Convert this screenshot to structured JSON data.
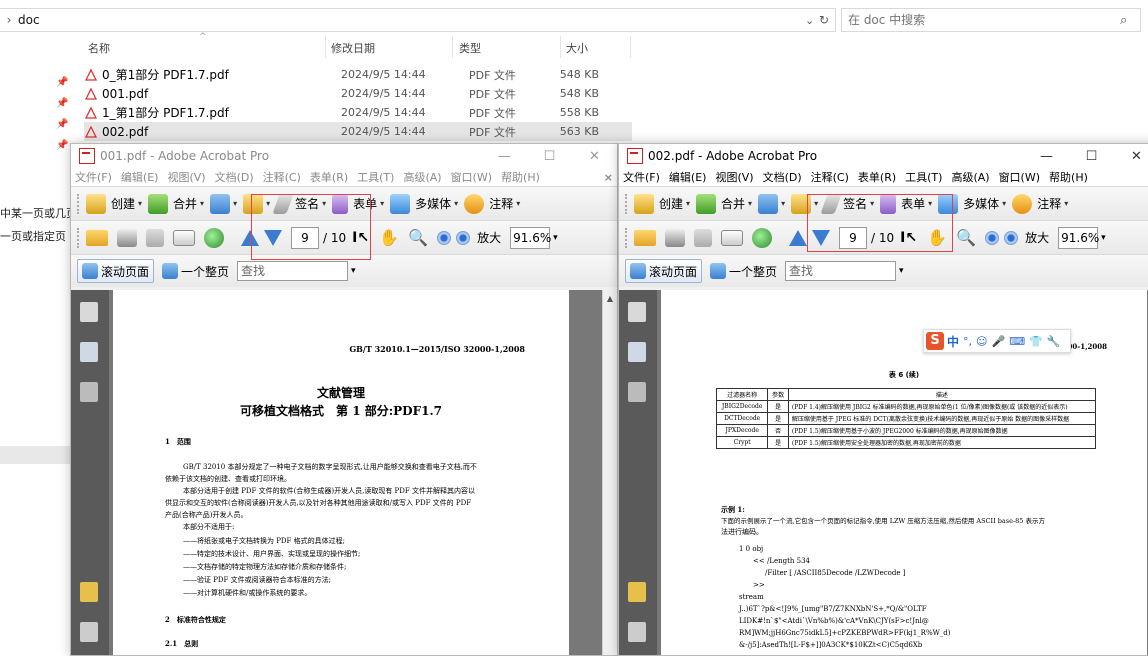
{
  "explorer": {
    "path": "doc",
    "search_placeholder": "在 doc 中搜索",
    "columns": {
      "name": "名称",
      "date": "修改日期",
      "type": "类型",
      "size": "大小"
    },
    "files": [
      {
        "name": "0_第1部分 PDF1.7.pdf",
        "date": "2024/9/5 14:44",
        "type": "PDF 文件",
        "size": "548 KB"
      },
      {
        "name": "001.pdf",
        "date": "2024/9/5 14:44",
        "type": "PDF 文件",
        "size": "548 KB"
      },
      {
        "name": "1_第1部分 PDF1.7.pdf",
        "date": "2024/9/5 14:44",
        "type": "PDF 文件",
        "size": "558 KB"
      },
      {
        "name": "002.pdf",
        "date": "2024/9/5 14:44",
        "type": "PDF 文件",
        "size": "563 KB"
      }
    ],
    "left_fragments": [
      "中某一页或几页",
      "一页或指定页"
    ]
  },
  "window1": {
    "title": "001.pdf - Adobe Acrobat Pro",
    "menu": [
      "文件(F)",
      "编辑(E)",
      "视图(V)",
      "文档(D)",
      "注释(C)",
      "表单(R)",
      "工具(T)",
      "高级(A)",
      "窗口(W)",
      "帮助(H)"
    ],
    "menu_close": "×",
    "toolbar1": {
      "create": "创建",
      "combine": "合并",
      "sign": "签名",
      "forms": "表单",
      "multimedia": "多媒体",
      "comment": "注释"
    },
    "toolbar2": {
      "page": "9",
      "total": "/ 10",
      "zoom_in": "放大",
      "zoom": "91.6%"
    },
    "toolbar3": {
      "scroll": "滚动页面",
      "single": "一个整页",
      "find_placeholder": "查找"
    },
    "doc": {
      "std": "GB/T 32010.1—2015/ISO 32000-1,2008",
      "title1": "文献管理",
      "title2": "可移植文档格式　第 1 部分:PDF1.7",
      "sec1": "1　范围",
      "p1": "GB/T 32010 本部分规定了一种电子文档的数字呈现形式,让用户能够交换和查看电子文档,而不",
      "p1b": "依赖于该文档的创建、查看或打印环境。",
      "p2": "本部分适用于创建 PDF 文件的软件(合称生成器)开发人员,读取现有 PDF 文件并解释其内容以",
      "p2b": "供显示和交互的软件(合称阅读器)开发人员,以及针对各种其他用途读取和/或写入 PDF 文件的 PDF",
      "p2c": "产品(合称产品)开发人员。",
      "p3": "本部分不适用于:",
      "l1": "——将纸张或电子文档转换为 PDF 格式的具体过程;",
      "l2": "——特定的技术设计、用户界面、实现或呈现的操作细节;",
      "l3": "——文档存储的特定物理方法如存储介质和存储条件;",
      "l4": "——验证 PDF 文件或阅读器符合本标准的方法;",
      "l5": "——对计算机硬件和/或操作系统的要求。",
      "sec2": "2　标准符合性规定",
      "sec21": "2.1　总则"
    }
  },
  "window2": {
    "title": "002.pdf - Adobe Acrobat Pro",
    "menu": [
      "文件(F)",
      "编辑(E)",
      "视图(V)",
      "文档(D)",
      "注释(C)",
      "表单(R)",
      "工具(T)",
      "高级(A)",
      "窗口(W)",
      "帮助(H)"
    ],
    "toolbar1": {
      "create": "创建",
      "combine": "合并",
      "sign": "签名",
      "forms": "表单",
      "multimedia": "多媒体",
      "comment": "注释"
    },
    "toolbar2": {
      "page": "9",
      "total": "/ 10",
      "zoom_in": "放大",
      "zoom": "91.6%"
    },
    "toolbar3": {
      "scroll": "滚动页面",
      "single": "一个整页",
      "find_placeholder": "查找"
    },
    "ime": {
      "zh": "中"
    },
    "doc": {
      "std": "GB/T 32010.1—2015/ISO 32000-1,2008",
      "table_caption": "表 6 (续)",
      "table_headers": [
        "过滤器名称",
        "参数",
        "描述"
      ],
      "table_rows": [
        [
          "JBIG2Decode",
          "是",
          "(PDF 1.4)解压缩使用 JBIG2 标准编码的数据,再现原始单色(1 位/像素)图像数据(或 该数据的近似表示)"
        ],
        [
          "DCTDecode",
          "是",
          "解压缩使用基于 JPEG 标准的 DCT(离散余弦变换)技术编码的数据,再现近似于原始 数据的图像采样数据"
        ],
        [
          "JPXDecode",
          "否",
          "(PDF 1.5)解压缩使用基于小波的 JPEG2000 标准编码的数据,再现原始图像数据"
        ],
        [
          "Crypt",
          "是",
          "(PDF 1.5)解压缩使用安全处理器加密的数据,再现加密前的数据"
        ]
      ],
      "ex": "示例 1:",
      "ex1": "下面的示例展示了一个流,它包含一个页面的标记指令,使用 LZW 压缩方法压缩,然后使用 ASCII base-85 表示方",
      "ex1b": "法进行编码。",
      "c1": "1 0 obj",
      "c2": "<< /Length 534",
      "c3": "/Filter [ /ASCII85Decode /LZWDecode ]",
      "c4": ">>",
      "c5": "stream",
      "c6": "J..)6T`?p&<!J9%_[umg\"B7/Z7KNXbN'S+,*Q/&\"OLTF",
      "c7": "LIDK#!n`$\"<Atdi`\\Vn%b%)&'cA*VnK\\CJY(sF>c!Jnl@",
      "c8": "RM]WM;jjH6Gnc75idkL5]+cPZKEBPWdR>FF(kj1_R%W_d)",
      "c9": "&-/j5]:AsedTh![L-F$+]]0A3CK*$10KZt<C)C5qd6Xb"
    }
  }
}
